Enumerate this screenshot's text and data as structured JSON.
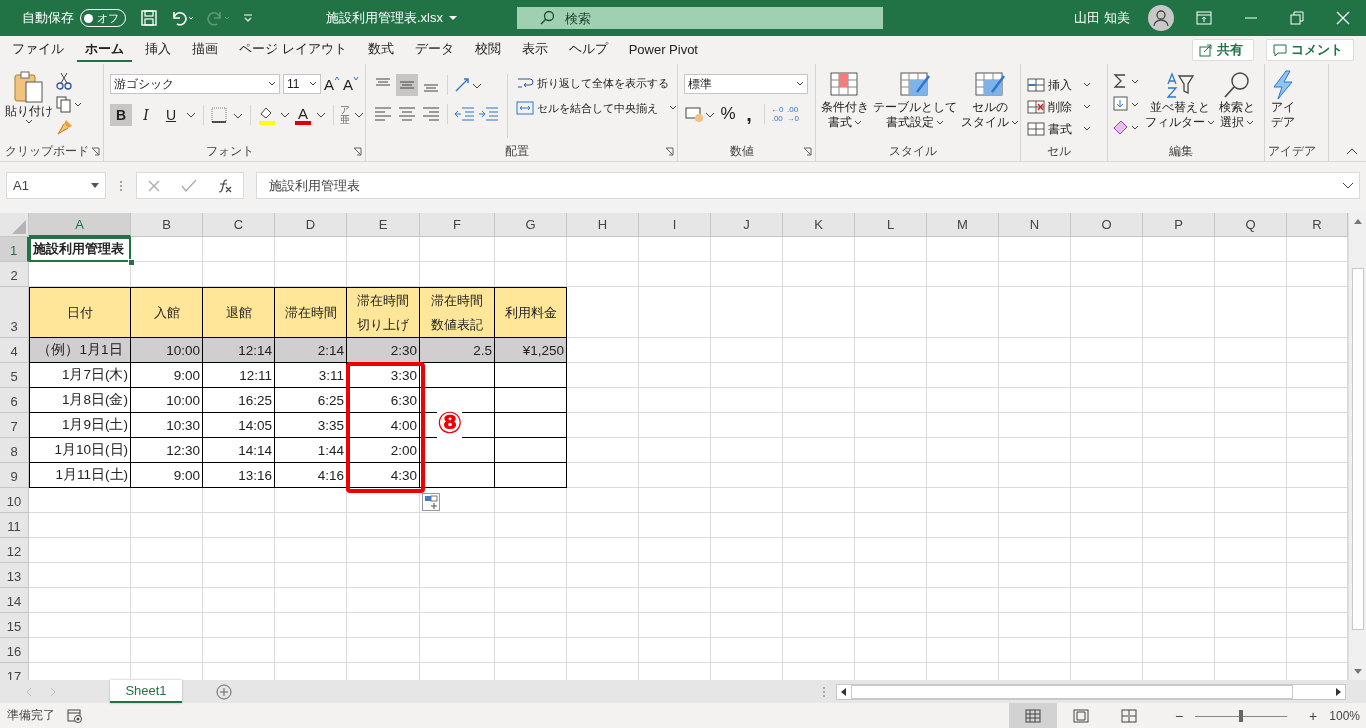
{
  "title_bar": {
    "autosave_label": "自動保存",
    "autosave": {
      "label": "オフ",
      "on": false
    },
    "file_name": "施設利用管理表.xlsx",
    "search_placeholder": "検索",
    "user_name": "山田 知美"
  },
  "ribbon_tabs": [
    {
      "label": "ファイル",
      "selected": false
    },
    {
      "label": "ホーム",
      "selected": true
    },
    {
      "label": "挿入",
      "selected": false
    },
    {
      "label": "描画",
      "selected": false
    },
    {
      "label": "ページ レイアウト",
      "selected": false
    },
    {
      "label": "数式",
      "selected": false
    },
    {
      "label": "データ",
      "selected": false
    },
    {
      "label": "校閲",
      "selected": false
    },
    {
      "label": "表示",
      "selected": false
    },
    {
      "label": "ヘルプ",
      "selected": false
    },
    {
      "label": "Power Pivot",
      "selected": false
    }
  ],
  "share_button": "共有",
  "comment_button": "コメント",
  "ribbon": {
    "clipboard": {
      "paste": "貼り付け",
      "label": "クリップボード"
    },
    "font": {
      "font_name": "游ゴシック",
      "font_size": "11",
      "grow": "A",
      "shrink": "A",
      "styles": [
        {
          "label": "B",
          "selected": true
        },
        {
          "label": "I",
          "selected": false
        },
        {
          "label": "U",
          "selected": false
        }
      ],
      "font_color": "A",
      "phonetic_top": "ア",
      "phonetic_bottom": "亜",
      "label": "フォント"
    },
    "alignment": {
      "vertical_buttons": [
        {
          "selected": false
        },
        {
          "selected": true
        },
        {
          "selected": false
        }
      ],
      "wrap": "折り返して全体を表示する",
      "merge": "セルを結合して中央揃え",
      "label": "配置"
    },
    "number": {
      "format": "標準",
      "percent": "%",
      "comma": ",",
      "increase_decimal": [
        "←0",
        ".00"
      ],
      "decrease_decimal": [
        ".00",
        "→0"
      ],
      "label": "数値"
    },
    "styles": {
      "buttons": [
        {
          "lines": [
            "条件付き",
            "書式"
          ]
        },
        {
          "lines": [
            "テーブルとして",
            "書式設定"
          ]
        },
        {
          "lines": [
            "セルの",
            "スタイル"
          ]
        }
      ],
      "label": "スタイル"
    },
    "cells": {
      "buttons": [
        "挿入",
        "削除",
        "書式"
      ],
      "label": "セル"
    },
    "editing": {
      "buttons": [
        {
          "lines": [
            "並べ替えと",
            "フィルター"
          ]
        },
        {
          "lines": [
            "検索と",
            "選択"
          ]
        }
      ],
      "label": "編集"
    },
    "ideas": {
      "lines": [
        "アイ",
        "デア"
      ],
      "label": "アイデア"
    }
  },
  "formula_bar": {
    "name_box": "A1",
    "formula": "施設利用管理表"
  },
  "sheet": {
    "columns": [
      {
        "label": "A",
        "selected": true
      },
      {
        "label": "B",
        "selected": false
      },
      {
        "label": "C",
        "selected": false
      },
      {
        "label": "D",
        "selected": false
      },
      {
        "label": "E",
        "selected": false
      },
      {
        "label": "F",
        "selected": false
      },
      {
        "label": "G",
        "selected": false
      },
      {
        "label": "H",
        "selected": false
      },
      {
        "label": "I",
        "selected": false
      },
      {
        "label": "J",
        "selected": false
      },
      {
        "label": "K",
        "selected": false
      },
      {
        "label": "L",
        "selected": false
      },
      {
        "label": "M",
        "selected": false
      },
      {
        "label": "N",
        "selected": false
      },
      {
        "label": "O",
        "selected": false
      },
      {
        "label": "P",
        "selected": false
      },
      {
        "label": "Q",
        "selected": false
      },
      {
        "label": "R",
        "selected": false
      }
    ],
    "rows": [
      {
        "label": "1",
        "selected": true,
        "kind": "title",
        "cells": [
          "施設利用管理表"
        ]
      },
      {
        "label": "2",
        "selected": false,
        "kind": "blank",
        "cells": []
      },
      {
        "label": "3",
        "selected": false,
        "kind": "header",
        "cells": [
          "日付",
          "入館",
          "退館",
          "滞在時間",
          "滞在時間切り上げ",
          "滞在時間数値表記",
          "利用料金"
        ]
      },
      {
        "label": "4",
        "selected": false,
        "kind": "example",
        "cells": [
          "（例）1月1日",
          "10:00",
          "12:14",
          "2:14",
          "2:30",
          "2.5",
          "¥1,250"
        ]
      },
      {
        "label": "5",
        "selected": false,
        "kind": "data",
        "cells": [
          "1月7日(木)",
          "9:00",
          "12:11",
          "3:11",
          "3:30"
        ]
      },
      {
        "label": "6",
        "selected": false,
        "kind": "data",
        "cells": [
          "1月8日(金)",
          "10:00",
          "16:25",
          "6:25",
          "6:30"
        ]
      },
      {
        "label": "7",
        "selected": false,
        "kind": "data",
        "cells": [
          "1月9日(土)",
          "10:30",
          "14:05",
          "3:35",
          "4:00"
        ]
      },
      {
        "label": "8",
        "selected": false,
        "kind": "data",
        "cells": [
          "1月10日(日)",
          "12:30",
          "14:14",
          "1:44",
          "2:00"
        ]
      },
      {
        "label": "9",
        "selected": false,
        "kind": "data",
        "cells": [
          "1月11日(土)",
          "9:00",
          "13:16",
          "4:16",
          "4:30"
        ]
      },
      {
        "label": "10",
        "selected": false,
        "kind": "blank",
        "cells": []
      },
      {
        "label": "11",
        "selected": false,
        "kind": "blank",
        "cells": []
      },
      {
        "label": "12",
        "selected": false,
        "kind": "blank",
        "cells": []
      },
      {
        "label": "13",
        "selected": false,
        "kind": "blank",
        "cells": []
      },
      {
        "label": "14",
        "selected": false,
        "kind": "blank",
        "cells": []
      },
      {
        "label": "15",
        "selected": false,
        "kind": "blank",
        "cells": []
      },
      {
        "label": "16",
        "selected": false,
        "kind": "blank",
        "cells": []
      },
      {
        "label": "17",
        "selected": false,
        "kind": "blank",
        "cells": []
      }
    ]
  },
  "annotation": {
    "label": "⑧"
  },
  "sheet_tabs": [
    {
      "label": "Sheet1",
      "selected": true
    }
  ],
  "status_bar": {
    "status": "準備完了",
    "views": [
      {
        "selected": true
      },
      {
        "selected": false
      },
      {
        "selected": false
      }
    ],
    "zoom_out": "−",
    "zoom_in": "+",
    "zoom_slider": {
      "level": 0.5
    },
    "zoom": "100%"
  }
}
